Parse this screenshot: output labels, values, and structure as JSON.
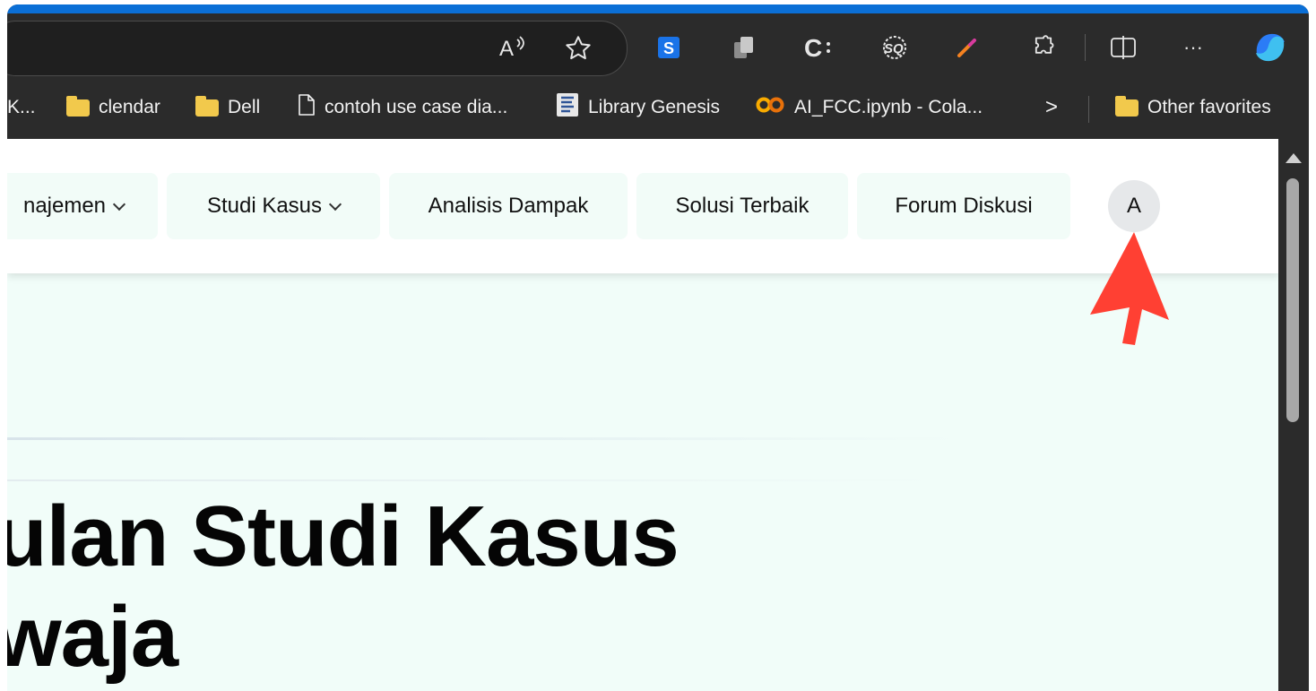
{
  "toolbar": {
    "read_aloud_icon": "read-aloud-icon",
    "more_label": "···"
  },
  "bookmarks": {
    "truncated_label": "K...",
    "items": [
      {
        "label": "clendar",
        "icon": "folder-icon"
      },
      {
        "label": "Dell",
        "icon": "folder-icon"
      },
      {
        "label": "contoh use case dia...",
        "icon": "document-icon"
      },
      {
        "label": "Library Genesis",
        "icon": "library-genesis-icon"
      },
      {
        "label": "AI_FCC.ipynb - Cola...",
        "icon": "colab-icon"
      }
    ],
    "overflow_label": ">",
    "other_favorites": "Other favorites"
  },
  "nav": {
    "items": [
      {
        "label": "najemen",
        "has_dropdown": true
      },
      {
        "label": "Studi Kasus",
        "has_dropdown": true
      },
      {
        "label": "Analisis Dampak",
        "has_dropdown": false
      },
      {
        "label": "Solusi Terbaik",
        "has_dropdown": false
      },
      {
        "label": "Forum Diskusi",
        "has_dropdown": false
      }
    ],
    "avatar_initial": "A"
  },
  "hero": {
    "line1": "ulan Studi Kasus",
    "line2": "waja"
  },
  "colors": {
    "accent_bar": "#0b6fd6",
    "page_bg": "#f1fdf9",
    "arrow": "#ff4033"
  }
}
